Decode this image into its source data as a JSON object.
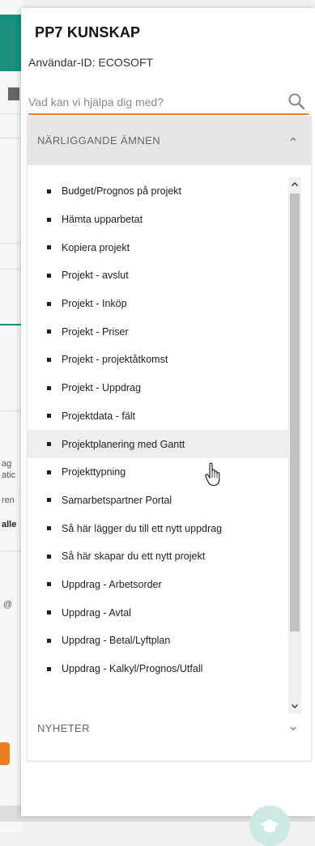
{
  "panel": {
    "title": "PP7 KUNSKAP",
    "user_id": "Användar-ID: ECOSOFT"
  },
  "search": {
    "placeholder": "Vad kan vi hjälpa dig med?",
    "value": "",
    "icon": "search-icon"
  },
  "related": {
    "header": "NÄRLIGGANDE ÄMNEN",
    "expanded": true,
    "items": [
      {
        "label": "Budget/Prognos på projekt"
      },
      {
        "label": "Hämta upparbetat"
      },
      {
        "label": "Kopiera projekt"
      },
      {
        "label": "Projekt - avslut"
      },
      {
        "label": "Projekt - Inköp"
      },
      {
        "label": "Projekt - Priser"
      },
      {
        "label": "Projekt - projektåtkomst"
      },
      {
        "label": "Projekt - Uppdrag"
      },
      {
        "label": "Projektdata - fält"
      },
      {
        "label": "Projektplanering med Gantt"
      },
      {
        "label": "Projekttypning"
      },
      {
        "label": "Samarbetspartner Portal"
      },
      {
        "label": "Så här lägger du till ett nytt uppdrag"
      },
      {
        "label": "Så här skapar du ett nytt projekt"
      },
      {
        "label": "Uppdrag - Arbetsorder"
      },
      {
        "label": "Uppdrag - Avtal"
      },
      {
        "label": "Uppdrag - Betal/Lyftplan"
      },
      {
        "label": "Uppdrag - Kalkyl/Prognos/Utfall"
      }
    ],
    "hovered_index": 9
  },
  "news": {
    "header": "NYHETER",
    "expanded": false
  },
  "background_fragments": [
    "ag",
    "atic",
    "ren",
    "alle",
    "@"
  ],
  "colors": {
    "accent": "#ee7d1f",
    "teal": "#17907f",
    "fab": "#cde9e6"
  }
}
